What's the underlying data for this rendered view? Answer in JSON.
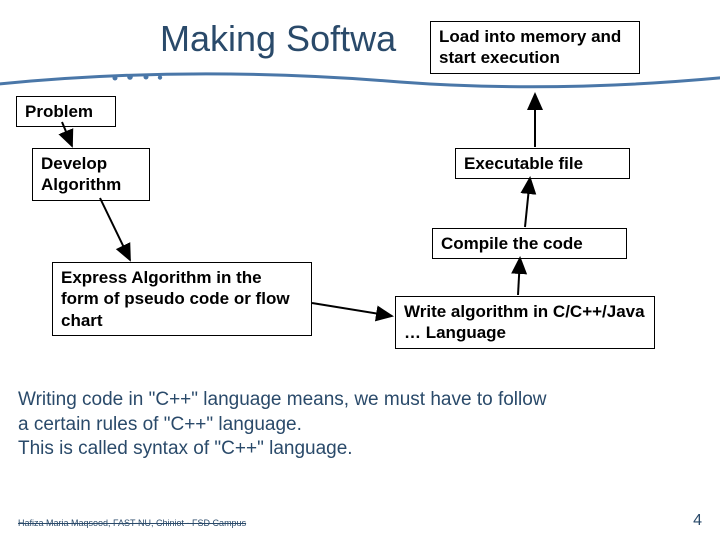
{
  "title": "Making Softwa",
  "boxes": {
    "problem": "Problem",
    "develop": "Develop Algorithm",
    "express": "Express Algorithm in the form of pseudo code or flow chart",
    "write": "Write algorithm in C/C++/Java … Language",
    "compile": "Compile the code",
    "exec": "Executable file",
    "load": "Load into memory and start execution"
  },
  "note_lines": {
    "l1": "Writing code in \"C++\" language means, we must have to follow",
    "l2": "a certain rules of \"C++\" language.",
    "l3": "This is called syntax of \"C++\" language."
  },
  "footer": "Hafiza Maria Maqsood, FAST-NU, Chiniot - FSD Campus",
  "slide_number": "4"
}
